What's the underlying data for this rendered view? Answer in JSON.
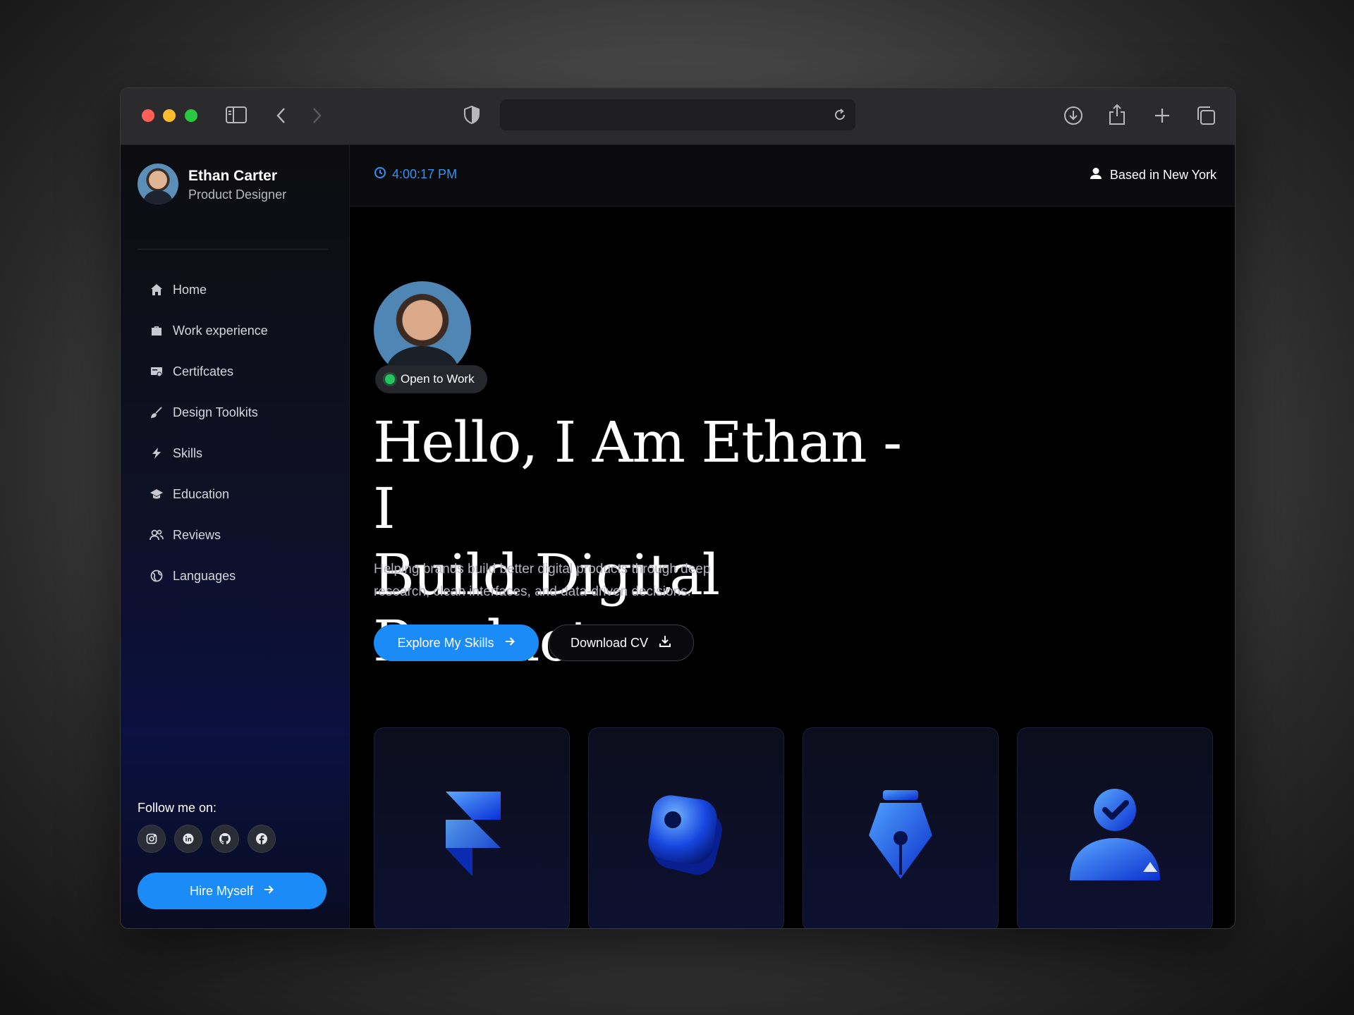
{
  "browser": {
    "url": "",
    "controls": [
      "sidebar-toggle-icon",
      "back-icon",
      "forward-icon",
      "privacy-shield-icon",
      "reload-icon",
      "download-icon",
      "share-icon",
      "new-tab-icon",
      "tabs-overview-icon"
    ]
  },
  "sidebar": {
    "profile": {
      "name": "Ethan Carter",
      "role": "Product Designer"
    },
    "nav": [
      {
        "label": "Home",
        "icon": "home-icon"
      },
      {
        "label": "Work experience",
        "icon": "briefcase-icon"
      },
      {
        "label": "Certifcates",
        "icon": "certificate-icon"
      },
      {
        "label": "Design Toolkits",
        "icon": "brush-icon"
      },
      {
        "label": "Skills",
        "icon": "lightning-icon"
      },
      {
        "label": "Education",
        "icon": "graduation-cap-icon"
      },
      {
        "label": "Reviews",
        "icon": "users-icon"
      },
      {
        "label": "Languages",
        "icon": "globe-icon"
      }
    ],
    "follow_label": "Follow me on:",
    "socials": [
      "instagram-icon",
      "linkedin-icon",
      "github-icon",
      "facebook-icon"
    ],
    "hire_button": "Hire Myself"
  },
  "topbar": {
    "time": "4:00:17 PM",
    "location": "Based in New York"
  },
  "hero": {
    "status_badge": "Open to Work",
    "headline_line1": "Hello, I Am Ethan - I",
    "headline_line2": "Build Digital Products",
    "subtitle": "Helping brands build better digital products through deep research, clean interfaces, and data-driven decisions.",
    "primary_button": "Explore My Skills",
    "secondary_button": "Download CV"
  },
  "cards": [
    {
      "icon": "framer-logo-icon"
    },
    {
      "icon": "image-stack-icon"
    },
    {
      "icon": "pen-nib-icon"
    },
    {
      "icon": "verified-user-icon"
    }
  ],
  "colors": {
    "accent": "#1b8cf7",
    "time_text": "#2f93f5",
    "status_green": "#22c55e",
    "background": "#000000"
  }
}
